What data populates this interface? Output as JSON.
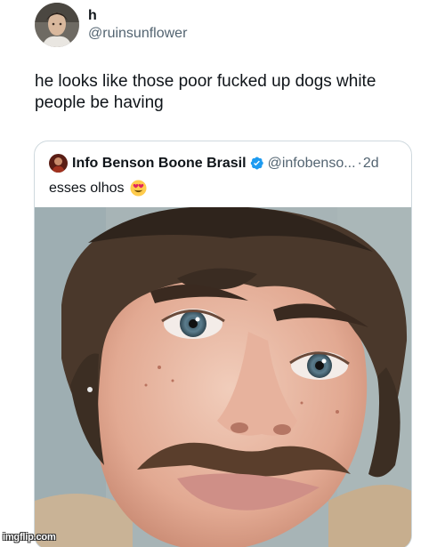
{
  "tweet": {
    "author": {
      "display_name": "h",
      "handle": "@ruinsunflower"
    },
    "text": "he looks like those poor fucked up dogs white people be having"
  },
  "quote": {
    "author": {
      "display_name": "Info Benson Boone Brasil",
      "handle": "@infobenso...",
      "separator": "·",
      "time": "2d",
      "verified": true
    },
    "text": "esses olhos",
    "emoji": "heart-eyes-emoji",
    "media": "photo-close-up-face"
  },
  "watermark": "imgflip.com",
  "colors": {
    "text": "#0f1419",
    "secondary": "#536471",
    "border": "#cfd9de",
    "verified": "#1d9bf0"
  }
}
